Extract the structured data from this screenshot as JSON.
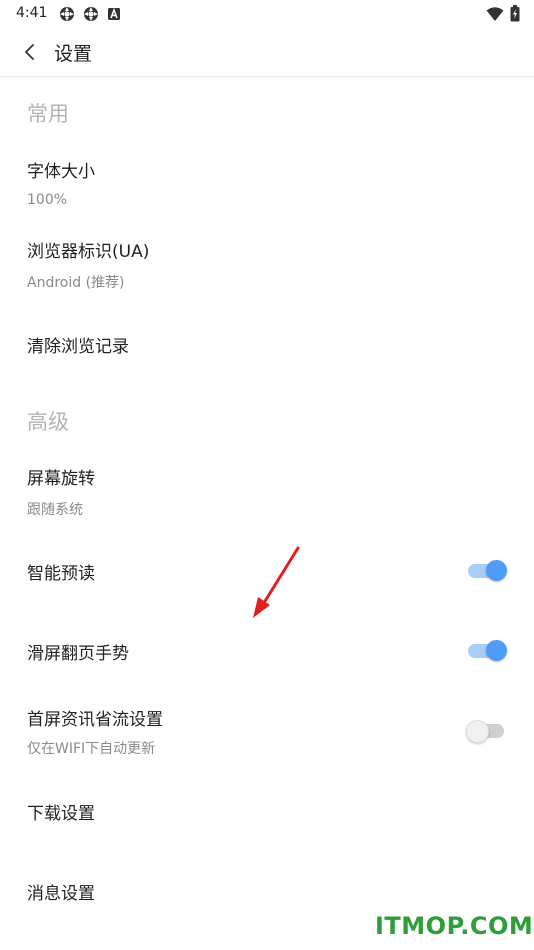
{
  "status_bar": {
    "time": "4:41",
    "left_icons": [
      "settings-gear-icon",
      "settings-gear-icon",
      "notification-a-icon"
    ],
    "right_icons": [
      "wifi-icon",
      "battery-charging-icon"
    ]
  },
  "app_bar": {
    "back_icon": "chevron-left-icon",
    "title": "设置"
  },
  "sections": {
    "common": {
      "header": "常用"
    },
    "advanced": {
      "header": "高级"
    }
  },
  "rows": {
    "font_size": {
      "title": "字体大小",
      "value": "100%"
    },
    "browser_ua": {
      "title": "浏览器标识(UA)",
      "value": "Android (推荐)"
    },
    "clear_history": {
      "title": "清除浏览记录"
    },
    "screen_rotation": {
      "title": "屏幕旋转",
      "value": "跟随系统"
    },
    "smart_preload": {
      "title": "智能预读",
      "enabled": true
    },
    "swipe_page_gesture": {
      "title": "滑屏翻页手势",
      "enabled": true
    },
    "home_data_saving": {
      "title": "首屏资讯省流设置",
      "subtitle": "仅在WIFI下自动更新",
      "enabled": false
    },
    "download_settings": {
      "title": "下载设置"
    },
    "message_settings": {
      "title": "消息设置"
    }
  },
  "colors": {
    "accent": "#4f9bf5",
    "accent_track": "#a9cdf7",
    "section_header": "#b4b4b4",
    "annotation_arrow": "#e02020",
    "watermark": "#2f9e3a"
  },
  "watermark": {
    "text": "ITMOP.COM"
  }
}
